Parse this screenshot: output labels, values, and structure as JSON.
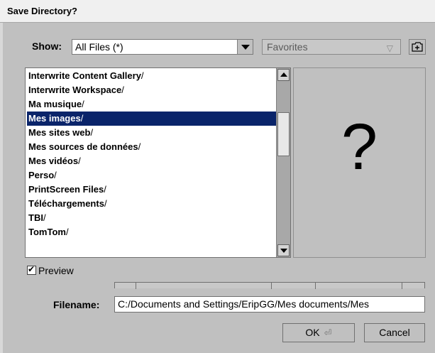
{
  "window": {
    "title": "Save Directory?"
  },
  "toolbar": {
    "show_label": "Show:",
    "show_value": "All Files (*)",
    "favorites_value": "Favorites"
  },
  "icons": {
    "show_dropdown": "chevron-down-icon",
    "favorites_dropdown": "triangle-down-outline-icon",
    "new_folder": "new-folder-icon",
    "scroll_up": "arrow-up-icon",
    "scroll_down": "arrow-down-icon",
    "enter": "return-icon"
  },
  "file_list": {
    "selected_index": 3,
    "items": [
      {
        "name": "Interwrite Content Gallery",
        "suffix": "/"
      },
      {
        "name": "Interwrite Workspace",
        "suffix": "/"
      },
      {
        "name": "Ma musique",
        "suffix": "/"
      },
      {
        "name": "Mes images",
        "suffix": "/"
      },
      {
        "name": "Mes sites web",
        "suffix": "/"
      },
      {
        "name": "Mes sources de données",
        "suffix": "/"
      },
      {
        "name": "Mes vidéos",
        "suffix": "/"
      },
      {
        "name": "Perso",
        "suffix": "/"
      },
      {
        "name": "PrintScreen Files",
        "suffix": "/"
      },
      {
        "name": "Téléchargements",
        "suffix": "/"
      },
      {
        "name": "TBI",
        "suffix": "/"
      },
      {
        "name": "TomTom",
        "suffix": "/"
      }
    ]
  },
  "preview": {
    "placeholder": "?",
    "checkbox_label": "Preview",
    "checked": true
  },
  "filename": {
    "label": "Filename:",
    "value": "C:/Documents and Settings/EripGG/Mes documents/Mes"
  },
  "buttons": {
    "ok": "OK",
    "cancel": "Cancel"
  },
  "colors": {
    "selection": "#0a246a",
    "window_bg": "#c0c0c0"
  }
}
